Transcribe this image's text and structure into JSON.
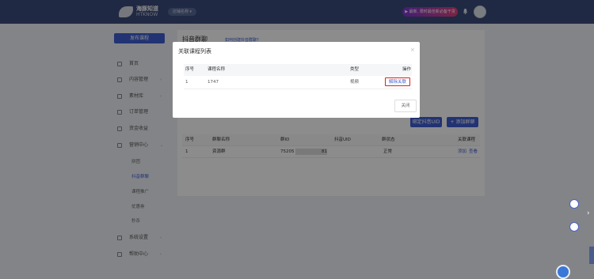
{
  "brand": {
    "name": "海豚知道",
    "sub": "HTKNOW"
  },
  "header": {
    "shop": "店铺名称 ▾",
    "promo": "▶ 最新, 限时最佳新必备干货"
  },
  "sidebar": {
    "publish": "发布课程",
    "items": [
      {
        "label": "首页"
      },
      {
        "label": "内容管理",
        "arrow": "›"
      },
      {
        "label": "素材库",
        "arrow": "›"
      },
      {
        "label": "订单管理"
      },
      {
        "label": "资金收益"
      },
      {
        "label": "营销中心",
        "arrow": "⌄"
      }
    ],
    "sub_items": [
      "拼团",
      "抖音群聊",
      "课程推广",
      "优惠券",
      "秒杀"
    ],
    "bottom_items": [
      {
        "label": "系统设置",
        "arrow": "›"
      },
      {
        "label": "帮助中心",
        "arrow": "›"
      }
    ]
  },
  "page": {
    "title": "抖音群聊",
    "link": "如何创建抖音群聊?",
    "fetch_btn": "绑定抖音UID",
    "add_btn": "+ 添加群聊",
    "table": {
      "headers": [
        "序号",
        "群聊名称",
        "群ID",
        "抖音UID",
        "群状态",
        "关联课程"
      ],
      "rows": [
        {
          "no": "1",
          "name": "资源群",
          "gid": "75205",
          "uid": "81",
          "status": "正常",
          "act1": "添加",
          "act2": "查看"
        }
      ]
    }
  },
  "modal": {
    "title": "关联课程列表",
    "close_icon": "×",
    "headers": [
      "序号",
      "课程名称",
      "类型",
      "操作"
    ],
    "rows": [
      {
        "no": "1",
        "name": "1747",
        "type": "视频",
        "action": "解除关联"
      }
    ],
    "close_btn": "关闭"
  }
}
